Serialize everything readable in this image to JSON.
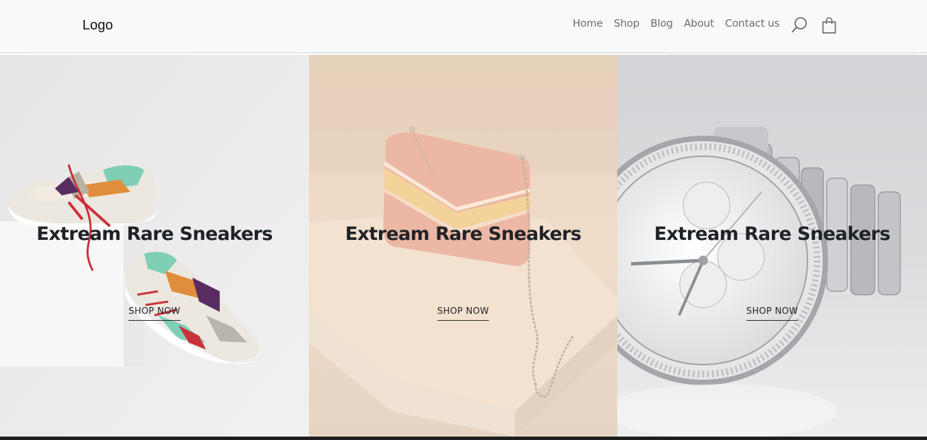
{
  "header": {
    "logo": "Logo",
    "nav": [
      {
        "label": "Home"
      },
      {
        "label": "Shop"
      },
      {
        "label": "Blog"
      },
      {
        "label": "About"
      },
      {
        "label": "Contact us"
      }
    ],
    "icons": [
      "search-icon",
      "shopping-bag-icon"
    ]
  },
  "panels": [
    {
      "title": "Extream Rare Sneakers",
      "cta": "SHOP NOW",
      "image": "sneakers-photo"
    },
    {
      "title": "Extream Rare Sneakers",
      "cta": "SHOP NOW",
      "image": "handbag-photo"
    },
    {
      "title": "Extream Rare Sneakers",
      "cta": "SHOP NOW",
      "image": "watch-photo"
    }
  ],
  "colors": {
    "navbar_bg": "#f8f9fa",
    "nav_text": "#6c6c6c",
    "title_text": "#1f2328",
    "panel1_bg": "#e8e8e8",
    "panel2_bg": "#ecd9c8",
    "panel3_bg": "#d3d6da"
  }
}
